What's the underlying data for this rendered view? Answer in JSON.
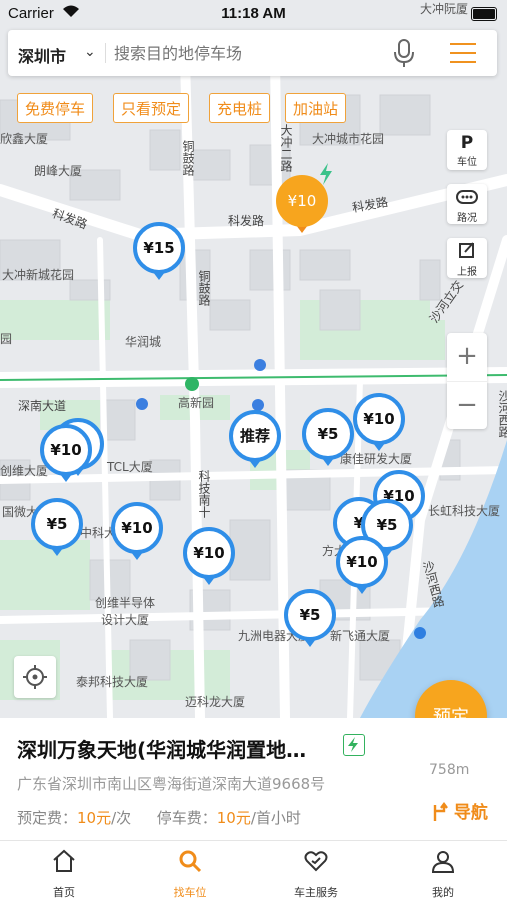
{
  "status_bar": {
    "carrier": "Carrier",
    "time": "11:18 AM"
  },
  "search": {
    "city": "深圳市",
    "placeholder": "搜索目的地停车场"
  },
  "filters": [
    "免费停车",
    "只看预定",
    "充电桩",
    "加油站"
  ],
  "side_tools": {
    "parking": "车位",
    "traffic": "路况",
    "report": "上报",
    "parking_glyph": "P"
  },
  "zoom": {
    "in": "+",
    "out": "−"
  },
  "map": {
    "roads": {
      "kefa1": "科发路",
      "kefa2": "科发路",
      "kefa3": "科发路",
      "shennan": "深南大道",
      "tonggu": "铜鼓路",
      "dachong2": "大冲二路",
      "keji10": "科技南十",
      "shahe": "沙河西路",
      "shahe_jiao": "沙河立交"
    },
    "pois": {
      "jianxin": "大冲新城花园",
      "dachongcheng": "大冲城市花园",
      "langwei": "朗峰大厦",
      "xinxin": "欣鑫大厦",
      "huarun": "华润城",
      "gaoxin": "高新园",
      "tcl": "TCL大厦",
      "kangjia": "康佳研发大厦",
      "chuangwei": "创维大厦",
      "changhong": "长虹科技大厦",
      "guowei": "国微大",
      "zhongke": "中科大厦",
      "chuangweibandaoti": "创维半导体设计大厦",
      "fangda": "方大",
      "jiuzhou": "九洲电器大厦",
      "xinfeitong": "新飞通大厦",
      "taibang": "泰邦科技大厦",
      "maikelong": "迈科龙大厦",
      "dachongruan": "大冲阮厦",
      "chuanyuan": "园"
    }
  },
  "pins": [
    {
      "text": "¥10",
      "style": "orange"
    },
    {
      "text": "¥15",
      "style": "blue"
    },
    {
      "text": "¥10",
      "style": "blue"
    },
    {
      "text": "推荐",
      "style": "blue"
    },
    {
      "text": "¥5",
      "style": "blue"
    },
    {
      "text": "¥10",
      "style": "blue"
    },
    {
      "text": "¥10",
      "style": "blue"
    },
    {
      "text": "¥5",
      "style": "blue"
    },
    {
      "text": "¥10",
      "style": "blue"
    },
    {
      "text": "¥10",
      "style": "blue"
    },
    {
      "text": "¥",
      "style": "blue"
    },
    {
      "text": "¥5",
      "style": "blue"
    },
    {
      "text": "¥10",
      "style": "blue"
    },
    {
      "text": "¥5",
      "style": "blue"
    }
  ],
  "reserve_button": "预定",
  "lot": {
    "name": "深圳万象天地(华润城华润置地…",
    "address": "广东省深圳市南山区粤海街道深南大道9668号",
    "reserve_fee_label": "预定费：",
    "reserve_fee_value": "10元",
    "reserve_fee_unit": "/次",
    "parking_fee_label": "停车费：",
    "parking_fee_value": "10元",
    "parking_fee_unit": "/首小时",
    "distance": "758m",
    "navigate": "导航"
  },
  "tabs": [
    {
      "label": "首页",
      "active": false
    },
    {
      "label": "找车位",
      "active": true
    },
    {
      "label": "车主服务",
      "active": false
    },
    {
      "label": "我的",
      "active": false
    }
  ],
  "colors": {
    "accent": "#f08c1a",
    "pin_blue": "#2f8ee8",
    "ev_green": "#33b25e"
  }
}
